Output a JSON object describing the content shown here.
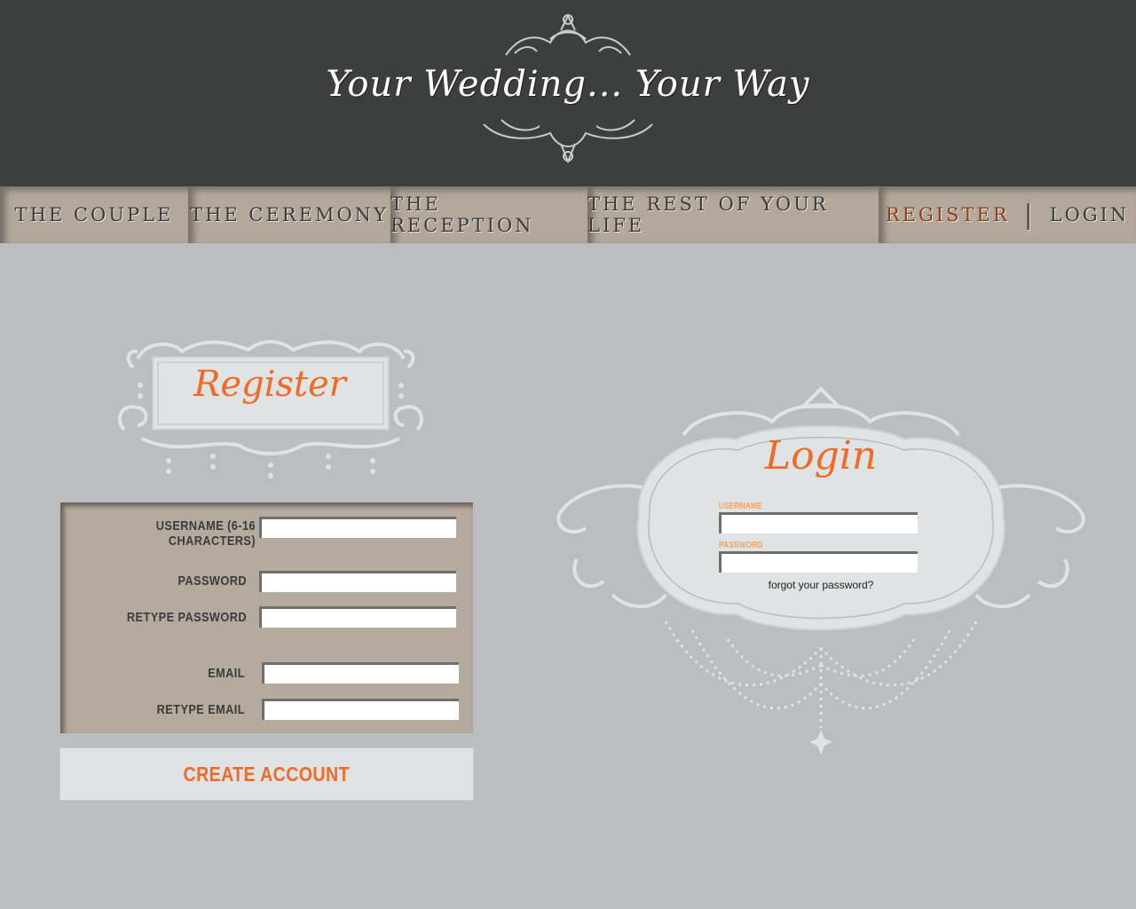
{
  "header": {
    "site_title": "Your Wedding... Your Way"
  },
  "nav": {
    "items": [
      {
        "label": "THE COUPLE"
      },
      {
        "label": "THE CEREMONY"
      },
      {
        "label": "THE RECEPTION"
      },
      {
        "label": "THE REST OF YOUR LIFE"
      }
    ],
    "register_label": "REGISTER",
    "separator": "|",
    "login_label": "LOGIN"
  },
  "register": {
    "title": "Register",
    "fields": {
      "username_label": "USERNAME (6-16 CHARACTERS)",
      "username_value": "",
      "password_label": "PASSWORD",
      "password_value": "",
      "retype_password_label": "RETYPE PASSWORD",
      "retype_password_value": "",
      "email_label": "EMAIL",
      "email_value": "",
      "retype_email_label": "RETYPE EMAIL",
      "retype_email_value": ""
    },
    "button_label": "CREATE ACCOUNT"
  },
  "login": {
    "title": "Login",
    "username_label": "USERNAME",
    "username_value": "",
    "password_label": "PASSWORD",
    "password_value": "",
    "forgot_link": "forgot your password?"
  },
  "colors": {
    "header_bg": "#3d3f3e",
    "nav_bg": "#b3a89b",
    "page_bg": "#bbbebe",
    "accent": "#f26a26",
    "form_bg": "#b5aa9e",
    "ornament": "#dfe3e3"
  }
}
